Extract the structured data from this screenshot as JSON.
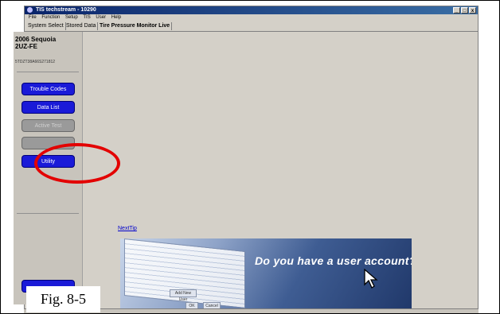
{
  "window": {
    "title": "TIS techstream - 10290",
    "controls": [
      "_",
      "□",
      "x"
    ]
  },
  "menu": [
    "File",
    "Function",
    "Setup",
    "TIS",
    "User",
    "Help"
  ],
  "tabs": [
    "System Select",
    "Stored Data",
    "Tire Pressure Monitor Live"
  ],
  "vehicle": {
    "model": "2006 Sequoia",
    "engine": "2UZ-FE",
    "vin": "5TDZT38A66S271812"
  },
  "sidebar_buttons": [
    {
      "label": "Trouble Codes",
      "state": "enabled"
    },
    {
      "label": "Data List",
      "state": "enabled"
    },
    {
      "label": "Active Test",
      "state": "disabled"
    },
    {
      "label": "",
      "state": "disabled"
    },
    {
      "label": "Utility",
      "state": "enabled"
    }
  ],
  "next_tip": "NextTip",
  "banner": {
    "slogan": "Do you have a user account?",
    "buttons": [
      "Add New User",
      "OK",
      "Cancel"
    ]
  },
  "figure_label": "Fig. 8-5",
  "colors": {
    "highlight": "#e30000",
    "button_blue": "#1a1ad8"
  }
}
